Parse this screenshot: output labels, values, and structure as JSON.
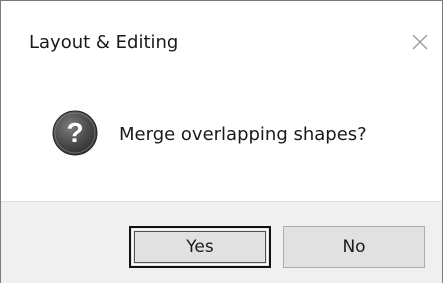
{
  "window": {
    "title": "Layout & Editing"
  },
  "dialog": {
    "icon": "question-icon",
    "message": "Merge overlapping shapes?"
  },
  "buttons": {
    "yes_label": "Yes",
    "no_label": "No"
  },
  "colors": {
    "footer_bg": "#f0f0f0",
    "button_bg": "#e1e1e1",
    "focus_border": "#111111",
    "icon_bg": "#4a4a4a",
    "text": "#1a1a1a"
  }
}
